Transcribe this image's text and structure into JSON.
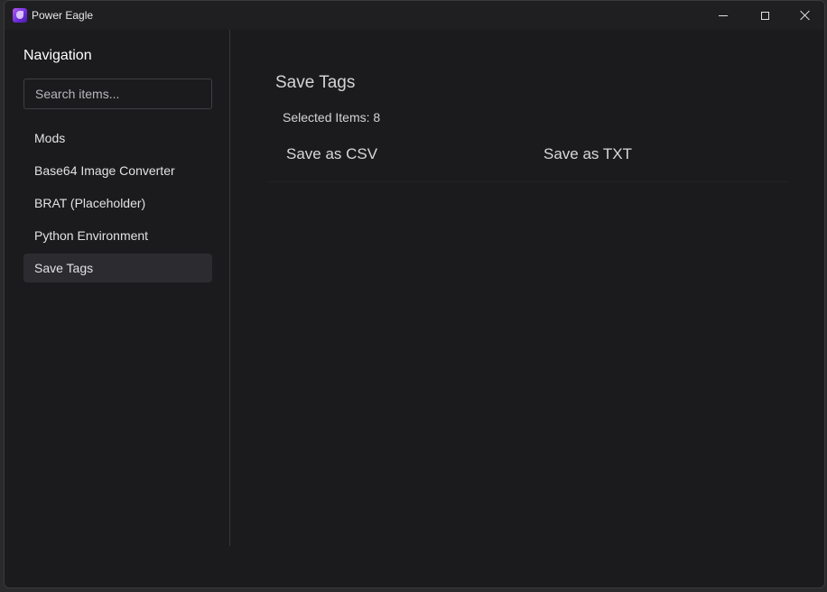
{
  "window": {
    "title": "Power Eagle",
    "controls": {
      "minimize_icon": "minimize-icon",
      "maximize_icon": "maximize-icon",
      "close_icon": "close-icon"
    }
  },
  "sidebar": {
    "heading": "Navigation",
    "search": {
      "placeholder": "Search items...",
      "value": ""
    },
    "items": [
      {
        "label": "Mods",
        "active": false
      },
      {
        "label": "Base64 Image Converter",
        "active": false
      },
      {
        "label": "BRAT (Placeholder)",
        "active": false
      },
      {
        "label": "Python Environment",
        "active": false
      },
      {
        "label": "Save Tags",
        "active": true
      }
    ]
  },
  "main": {
    "title": "Save Tags",
    "selected_items": "Selected Items: 8",
    "actions": {
      "save_csv": "Save as CSV",
      "save_txt": "Save as TXT"
    }
  },
  "colors": {
    "background": "#1b1b1e",
    "titlebar": "#1f1f21",
    "active_item": "#2c2c30",
    "app_icon_accent": "#8a3ee6"
  }
}
